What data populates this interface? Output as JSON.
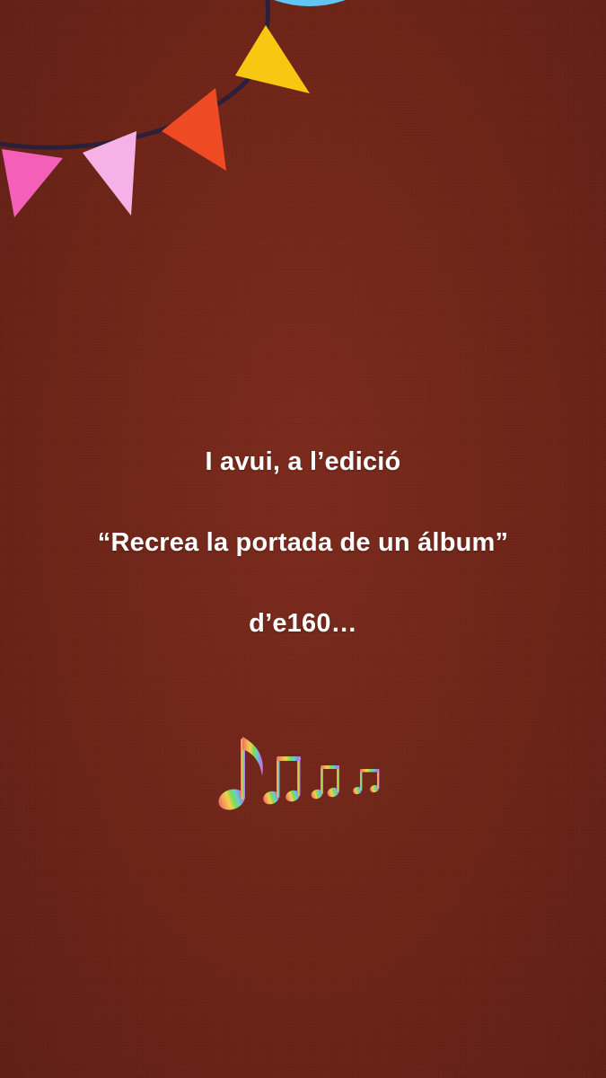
{
  "caption": {
    "line1": "I avui, a l’edició",
    "line2": "“Recrea la portada de un álbum”",
    "line3": "d’e160…"
  },
  "decorations": {
    "bunting": {
      "icon": "bunting-flags-icon",
      "string_color": "#2b1f3a",
      "flag_colors": [
        "#f45fb8",
        "#f6b2e6",
        "#ee4b24",
        "#f7c712",
        "#5fc7f2"
      ]
    },
    "notes": {
      "icon": "musical-notes-icon",
      "colors": [
        "#f06a6a",
        "#f2a35a",
        "#f2d14a",
        "#7ed957",
        "#5fd3c8",
        "#9a86f0",
        "#e07ad8"
      ]
    }
  },
  "colors": {
    "background": "#6e2316",
    "text": "#ffffff"
  }
}
